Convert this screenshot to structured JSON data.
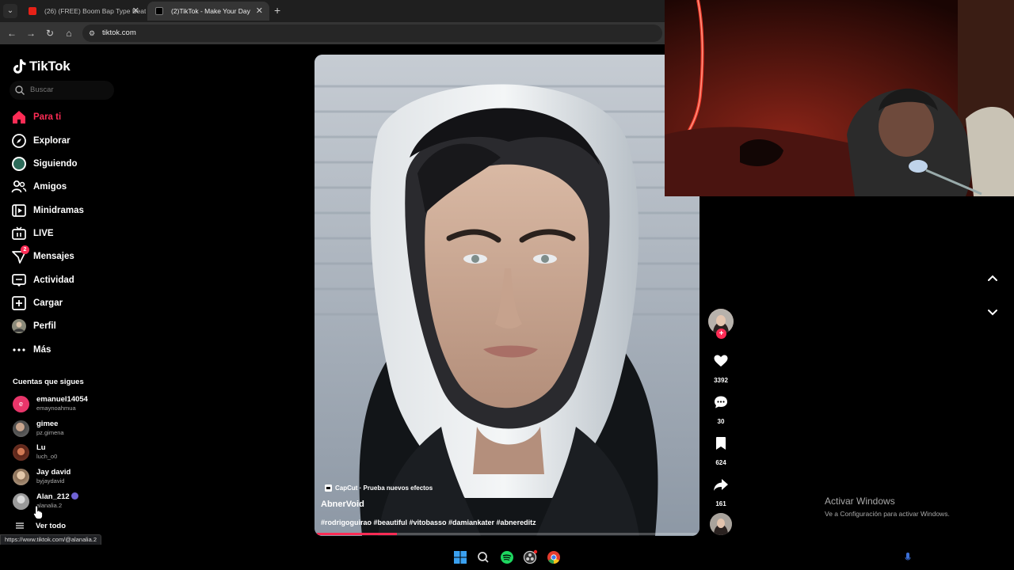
{
  "browser": {
    "tabs": [
      {
        "title": "(26) (FREE) Boom Bap Type Beat",
        "favicon": "youtube-icon",
        "active": false
      },
      {
        "title": "(2)TikTok - Make Your Day",
        "favicon": "tiktok-icon",
        "active": true
      }
    ],
    "url": "tiktok.com",
    "status_url": "https://www.tiktok.com/@alanalia.2"
  },
  "sidebar": {
    "logo": "TikTok",
    "search_placeholder": "Buscar",
    "nav": [
      {
        "label": "Para ti",
        "icon": "home-icon",
        "active": true
      },
      {
        "label": "Explorar",
        "icon": "compass-icon"
      },
      {
        "label": "Siguiendo",
        "icon": "following-avatar-icon"
      },
      {
        "label": "Amigos",
        "icon": "friends-icon"
      },
      {
        "label": "Minidramas",
        "icon": "film-icon"
      },
      {
        "label": "LIVE",
        "icon": "live-tv-icon"
      },
      {
        "label": "Mensajes",
        "icon": "messages-icon",
        "badge": "2"
      },
      {
        "label": "Actividad",
        "icon": "activity-icon"
      },
      {
        "label": "Cargar",
        "icon": "upload-icon"
      },
      {
        "label": "Perfil",
        "icon": "profile-avatar-icon"
      },
      {
        "label": "Más",
        "icon": "more-dots-icon"
      }
    ],
    "following_title": "Cuentas que sigues",
    "accounts": [
      {
        "name": "emanuel14054",
        "handle": "emaynoahmua",
        "avatar_color": "#e8366a",
        "initial": "e"
      },
      {
        "name": "gimee",
        "handle": "pz.gimena",
        "avatar_color": "#6d6d6d"
      },
      {
        "name": "Lu",
        "handle": "luch_o0",
        "avatar_color": "#7a3b2c"
      },
      {
        "name": "Jay david",
        "handle": "byjaydavid",
        "avatar_color": "#b8a48e"
      },
      {
        "name": "Alan_212",
        "handle": "alanalia.2",
        "avatar_color": "#9a9a9a",
        "verified": true
      }
    ],
    "see_all": "Ver todo"
  },
  "video": {
    "capcut_label": "CapCut · Prueba nuevos efectos",
    "author": "AbnerVoid",
    "hashtags": "#rodrigoguirao #beautiful #vitobasso #damiankater #abnereditz",
    "progress": 0.21
  },
  "actions": {
    "likes": "3392",
    "comments": "30",
    "saves": "624",
    "shares": "161"
  },
  "windows": {
    "activate_title": "Activar Windows",
    "activate_sub": "Ve a Configuración para activar Windows."
  },
  "colors": {
    "accent": "#fe2c55",
    "background": "#000000"
  }
}
